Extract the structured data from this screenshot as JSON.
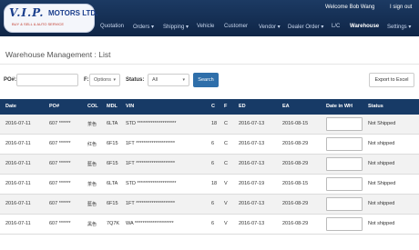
{
  "header": {
    "logo": {
      "brand": "V.I.P.",
      "name": "MOTORS LTD.",
      "tagline": "BUY & SELL & AUTO SERVICE"
    },
    "welcome": "Welcome  Bob Wang",
    "signout": "I sign out"
  },
  "nav": [
    {
      "label": "Quotation"
    },
    {
      "label": "Orders ▾"
    },
    {
      "label": "Shipping ▾"
    },
    {
      "label": "Vehicle"
    },
    {
      "label": "Customer"
    },
    {
      "label": "Vendor ▾"
    },
    {
      "label": "Dealer Order ▾"
    },
    {
      "label": "L/C"
    },
    {
      "label": "Warehouse"
    },
    {
      "label": "Settings ▾"
    }
  ],
  "page": {
    "title": "Warehouse Management :  List"
  },
  "filters": {
    "po_label": "PO#:",
    "po_value": "",
    "f_label": "F:",
    "f_value": "Options",
    "status_label": "Status:",
    "status_value": "All",
    "search_label": "Search",
    "export_label": "Export to Excel"
  },
  "table": {
    "headers": [
      "Date",
      "PO#",
      "COL",
      "MDL",
      "VIN",
      "C",
      "F",
      "ED",
      "EA",
      "Date in WH",
      "Status"
    ],
    "rows": [
      {
        "date": "2016-07-11",
        "po": "607 ******",
        "col": "茶色",
        "mdl": "6LTA",
        "vin": "STD ********************",
        "c": "18",
        "f": "C",
        "ed": "2016-07-13",
        "ea": "2016-08-15",
        "status": "Not Shipped"
      },
      {
        "date": "2016-07-11",
        "po": "607 ******",
        "col": "红色",
        "mdl": "6F15",
        "vin": "1FT ********************",
        "c": "6",
        "f": "C",
        "ed": "2016-07-13",
        "ea": "2016-08-29",
        "status": "Not shipped"
      },
      {
        "date": "2016-07-11",
        "po": "607 ******",
        "col": "藍色",
        "mdl": "6F15",
        "vin": "1FT ********************",
        "c": "6",
        "f": "C",
        "ed": "2016-07-13",
        "ea": "2016-08-29",
        "status": "Not shipped"
      },
      {
        "date": "2016-07-11",
        "po": "607 ******",
        "col": "茶色",
        "mdl": "6LTA",
        "vin": "STD ********************",
        "c": "18",
        "f": "V",
        "ed": "2016-07-19",
        "ea": "2016-08-15",
        "status": "Not Shipped"
      },
      {
        "date": "2016-07-11",
        "po": "607 ******",
        "col": "藍色",
        "mdl": "6F15",
        "vin": "1FT ********************",
        "c": "6",
        "f": "V",
        "ed": "2016-07-13",
        "ea": "2016-08-29",
        "status": "Not shipped"
      },
      {
        "date": "2016-07-11",
        "po": "607 ******",
        "col": "黑色",
        "mdl": "7Q7K",
        "vin": "WA ********************",
        "c": "6",
        "f": "V",
        "ed": "2016-07-13",
        "ea": "2016-08-29",
        "status": "Not shipped"
      }
    ]
  }
}
